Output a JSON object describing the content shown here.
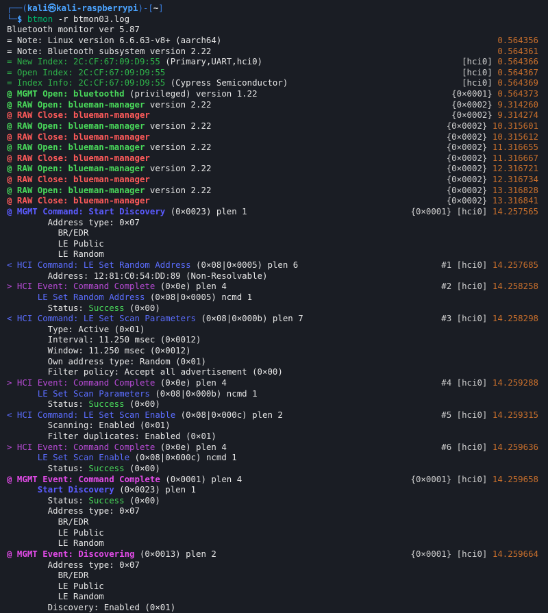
{
  "terminal": {
    "prompt": {
      "line1_prefix": "┌──(",
      "user": "kali",
      "at_icon": "㉿",
      "host": "kali-raspberrypi",
      "mid": ")-[",
      "dir": "~",
      "end": "]",
      "line2_prefix": "└─",
      "dollar": "$",
      "command": "btmon",
      "args": " -r btmon03.log"
    },
    "lines": [
      {
        "text": "Bluetooth monitor ver 5.87",
        "cls": "c-white"
      },
      {
        "text": "= Note: Linux version 6.6.63-v8+ (aarch64)",
        "ts": "0.564356",
        "cls": "c-white"
      },
      {
        "text": "= Note: Bluetooth subsystem version 2.22",
        "ts": "0.564361",
        "cls": "c-white"
      },
      {
        "parts": [
          {
            "t": "= New Index: 2C:CF:67:09:D9:55 ",
            "c": "c-dkgreen"
          },
          {
            "t": "(Primary,UART,hci0)",
            "c": "c-white"
          }
        ],
        "tag": "[hci0]",
        "ts": "0.564366"
      },
      {
        "parts": [
          {
            "t": "= Open Index: 2C:CF:67:09:D9:55",
            "c": "c-dkgreen"
          }
        ],
        "tag": "[hci0]",
        "ts": "0.564367"
      },
      {
        "parts": [
          {
            "t": "= Index Info: 2C:CF:67:09:D9:55 ",
            "c": "c-dkgreen"
          },
          {
            "t": "(Cypress Semiconductor)",
            "c": "c-white"
          }
        ],
        "tag": "[hci0]",
        "ts": "0.564369"
      },
      {
        "parts": [
          {
            "t": "@ MGMT Open: bluetoothd",
            "c": "c-green c-bold"
          },
          {
            "t": " (privileged) version 1.22",
            "c": "c-white"
          }
        ],
        "tag": "{0×0001}",
        "ts": "0.564373"
      },
      {
        "parts": [
          {
            "t": "@ RAW Open: blueman-manager",
            "c": "c-green c-bold"
          },
          {
            "t": " version 2.22",
            "c": "c-white"
          }
        ],
        "tag": "{0×0002}",
        "ts": "9.314260"
      },
      {
        "parts": [
          {
            "t": "@ RAW Close: blueman-manager",
            "c": "c-red c-bold"
          }
        ],
        "tag": "{0×0002}",
        "ts": "9.314274"
      },
      {
        "parts": [
          {
            "t": "@ RAW Open: blueman-manager",
            "c": "c-green c-bold"
          },
          {
            "t": " version 2.22",
            "c": "c-white"
          }
        ],
        "tag": "{0×0002}",
        "ts": "10.315601"
      },
      {
        "parts": [
          {
            "t": "@ RAW Close: blueman-manager",
            "c": "c-red c-bold"
          }
        ],
        "tag": "{0×0002}",
        "ts": "10.315612"
      },
      {
        "parts": [
          {
            "t": "@ RAW Open: blueman-manager",
            "c": "c-green c-bold"
          },
          {
            "t": " version 2.22",
            "c": "c-white"
          }
        ],
        "tag": "{0×0002}",
        "ts": "11.316655"
      },
      {
        "parts": [
          {
            "t": "@ RAW Close: blueman-manager",
            "c": "c-red c-bold"
          }
        ],
        "tag": "{0×0002}",
        "ts": "11.316667"
      },
      {
        "parts": [
          {
            "t": "@ RAW Open: blueman-manager",
            "c": "c-green c-bold"
          },
          {
            "t": " version 2.22",
            "c": "c-white"
          }
        ],
        "tag": "{0×0002}",
        "ts": "12.316721"
      },
      {
        "parts": [
          {
            "t": "@ RAW Close: blueman-manager",
            "c": "c-red c-bold"
          }
        ],
        "tag": "{0×0002}",
        "ts": "12.316734"
      },
      {
        "parts": [
          {
            "t": "@ RAW Open: blueman-manager",
            "c": "c-green c-bold"
          },
          {
            "t": " version 2.22",
            "c": "c-white"
          }
        ],
        "tag": "{0×0002}",
        "ts": "13.316828"
      },
      {
        "parts": [
          {
            "t": "@ RAW Close: blueman-manager",
            "c": "c-red c-bold"
          }
        ],
        "tag": "{0×0002}",
        "ts": "13.316841"
      },
      {
        "parts": [
          {
            "t": "@ MGMT Command: Start Discovery",
            "c": "c-mblue c-bold"
          },
          {
            "t": " (0×0023) plen 1",
            "c": "c-white"
          }
        ],
        "tag": "{0×0001} [hci0]",
        "ts": "14.257565"
      },
      {
        "text": "        Address type: 0×07",
        "cls": "c-white"
      },
      {
        "text": "          BR/EDR",
        "cls": "c-white"
      },
      {
        "text": "          LE Public",
        "cls": "c-white"
      },
      {
        "text": "          LE Random",
        "cls": "c-white"
      },
      {
        "parts": [
          {
            "t": "< HCI Command: LE Set Random Address",
            "c": "c-blue"
          },
          {
            "t": " (0×08|0×0005) plen 6",
            "c": "c-white"
          }
        ],
        "tag": "#1 [hci0]",
        "ts": "14.257685"
      },
      {
        "text": "        Address: 12:81:C0:54:DD:89 (Non-Resolvable)",
        "cls": "c-white"
      },
      {
        "parts": [
          {
            "t": "> HCI Event: Command Complete",
            "c": "c-magenta"
          },
          {
            "t": " (0×0e) plen 4",
            "c": "c-white"
          }
        ],
        "tag": "#2 [hci0]",
        "ts": "14.258258"
      },
      {
        "parts": [
          {
            "t": "      LE Set Random Address",
            "c": "c-blue"
          },
          {
            "t": " (0×08|0×0005) ncmd 1",
            "c": "c-white"
          }
        ]
      },
      {
        "parts": [
          {
            "t": "        Status: ",
            "c": "c-white"
          },
          {
            "t": "Success",
            "c": "c-green"
          },
          {
            "t": " (0×00)",
            "c": "c-white"
          }
        ]
      },
      {
        "parts": [
          {
            "t": "< HCI Command: LE Set Scan Parameters",
            "c": "c-blue"
          },
          {
            "t": " (0×08|0×000b) plen 7",
            "c": "c-white"
          }
        ],
        "tag": "#3 [hci0]",
        "ts": "14.258298"
      },
      {
        "text": "        Type: Active (0×01)",
        "cls": "c-white"
      },
      {
        "text": "        Interval: 11.250 msec (0×0012)",
        "cls": "c-white"
      },
      {
        "text": "        Window: 11.250 msec (0×0012)",
        "cls": "c-white"
      },
      {
        "text": "        Own address type: Random (0×01)",
        "cls": "c-white"
      },
      {
        "text": "        Filter policy: Accept all advertisement (0×00)",
        "cls": "c-white"
      },
      {
        "parts": [
          {
            "t": "> HCI Event: Command Complete",
            "c": "c-magenta"
          },
          {
            "t": " (0×0e) plen 4",
            "c": "c-white"
          }
        ],
        "tag": "#4 [hci0]",
        "ts": "14.259288"
      },
      {
        "parts": [
          {
            "t": "      LE Set Scan Parameters",
            "c": "c-blue"
          },
          {
            "t": " (0×08|0×000b) ncmd 1",
            "c": "c-white"
          }
        ]
      },
      {
        "parts": [
          {
            "t": "        Status: ",
            "c": "c-white"
          },
          {
            "t": "Success",
            "c": "c-green"
          },
          {
            "t": " (0×00)",
            "c": "c-white"
          }
        ]
      },
      {
        "parts": [
          {
            "t": "< HCI Command: LE Set Scan Enable",
            "c": "c-blue"
          },
          {
            "t": " (0×08|0×000c) plen 2",
            "c": "c-white"
          }
        ],
        "tag": "#5 [hci0]",
        "ts": "14.259315"
      },
      {
        "text": "        Scanning: Enabled (0×01)",
        "cls": "c-white"
      },
      {
        "text": "        Filter duplicates: Enabled (0×01)",
        "cls": "c-white"
      },
      {
        "parts": [
          {
            "t": "> HCI Event: Command Complete",
            "c": "c-magenta"
          },
          {
            "t": " (0×0e) plen 4",
            "c": "c-white"
          }
        ],
        "tag": "#6 [hci0]",
        "ts": "14.259636"
      },
      {
        "parts": [
          {
            "t": "      LE Set Scan Enable",
            "c": "c-blue"
          },
          {
            "t": " (0×08|0×000c) ncmd 1",
            "c": "c-white"
          }
        ]
      },
      {
        "parts": [
          {
            "t": "        Status: ",
            "c": "c-white"
          },
          {
            "t": "Success",
            "c": "c-green"
          },
          {
            "t": " (0×00)",
            "c": "c-white"
          }
        ]
      },
      {
        "parts": [
          {
            "t": "@ MGMT Event: Command Complete",
            "c": "c-brmagenta c-bold"
          },
          {
            "t": " (0×0001) plen 4",
            "c": "c-white"
          }
        ],
        "tag": "{0×0001} [hci0]",
        "ts": "14.259658"
      },
      {
        "parts": [
          {
            "t": "      Start Discovery",
            "c": "c-mblue c-bold"
          },
          {
            "t": " (0×0023) plen 1",
            "c": "c-white"
          }
        ]
      },
      {
        "parts": [
          {
            "t": "        Status: ",
            "c": "c-white"
          },
          {
            "t": "Success",
            "c": "c-green"
          },
          {
            "t": " (0×00)",
            "c": "c-white"
          }
        ]
      },
      {
        "text": "        Address type: 0×07",
        "cls": "c-white"
      },
      {
        "text": "          BR/EDR",
        "cls": "c-white"
      },
      {
        "text": "          LE Public",
        "cls": "c-white"
      },
      {
        "text": "          LE Random",
        "cls": "c-white"
      },
      {
        "parts": [
          {
            "t": "@ MGMT Event: Discovering",
            "c": "c-brmagenta c-bold"
          },
          {
            "t": " (0×0013) plen 2",
            "c": "c-white"
          }
        ],
        "tag": "{0×0001} [hci0]",
        "ts": "14.259664"
      },
      {
        "text": "        Address type: 0×07",
        "cls": "c-white"
      },
      {
        "text": "          BR/EDR",
        "cls": "c-white"
      },
      {
        "text": "          LE Public",
        "cls": "c-white"
      },
      {
        "text": "          LE Random",
        "cls": "c-white"
      },
      {
        "text": "        Discovery: Enabled (0×01)",
        "cls": "c-white"
      }
    ],
    "colors": {
      "background": "#1a1d24",
      "timestamp": "#c86f2c",
      "prompt_frame": "#3b7fe0"
    }
  }
}
